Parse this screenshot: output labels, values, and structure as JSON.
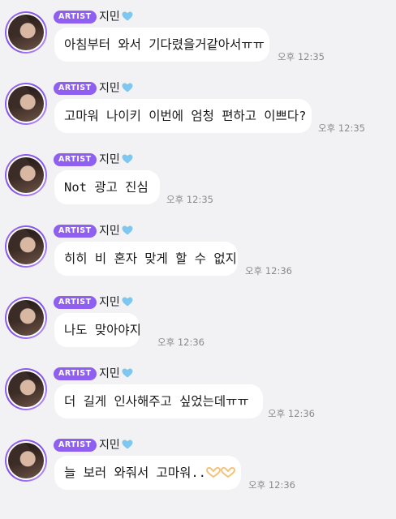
{
  "messages": [
    {
      "badge": "ARTIST",
      "name": "지민",
      "text": "아침부터 와서 기다렸을거같아서ㅠㅠ",
      "time": "오후 12:35"
    },
    {
      "badge": "ARTIST",
      "name": "지민",
      "text": "고마워 나이키 이번에 엄청 편하고 이쁘다?",
      "time": "오후 12:35"
    },
    {
      "badge": "ARTIST",
      "name": "지민",
      "text": "Not 광고 진심",
      "time": "오후 12:35"
    },
    {
      "badge": "ARTIST",
      "name": "지민",
      "text": "히히 비 혼자 맞게 할 수 없지",
      "time": "오후 12:36"
    },
    {
      "badge": "ARTIST",
      "name": "지민",
      "text": "나도 맞아야지",
      "time": "오후 12:36"
    },
    {
      "badge": "ARTIST",
      "name": "지민",
      "text": "더 길게 인사해주고 싶었는데ㅠㅠ",
      "time": "오후 12:36"
    },
    {
      "badge": "ARTIST",
      "name": "지민",
      "text": "늘 보러 와줘서 고마워..",
      "time": "오후 12:36"
    }
  ],
  "colors": {
    "badge": "#8f5fef",
    "heart": "#7ec8f0",
    "hands": "#f4c27a"
  },
  "icons": {
    "name_suffix": "light-blue-heart-icon",
    "emoji": "heart-hands-icon"
  }
}
